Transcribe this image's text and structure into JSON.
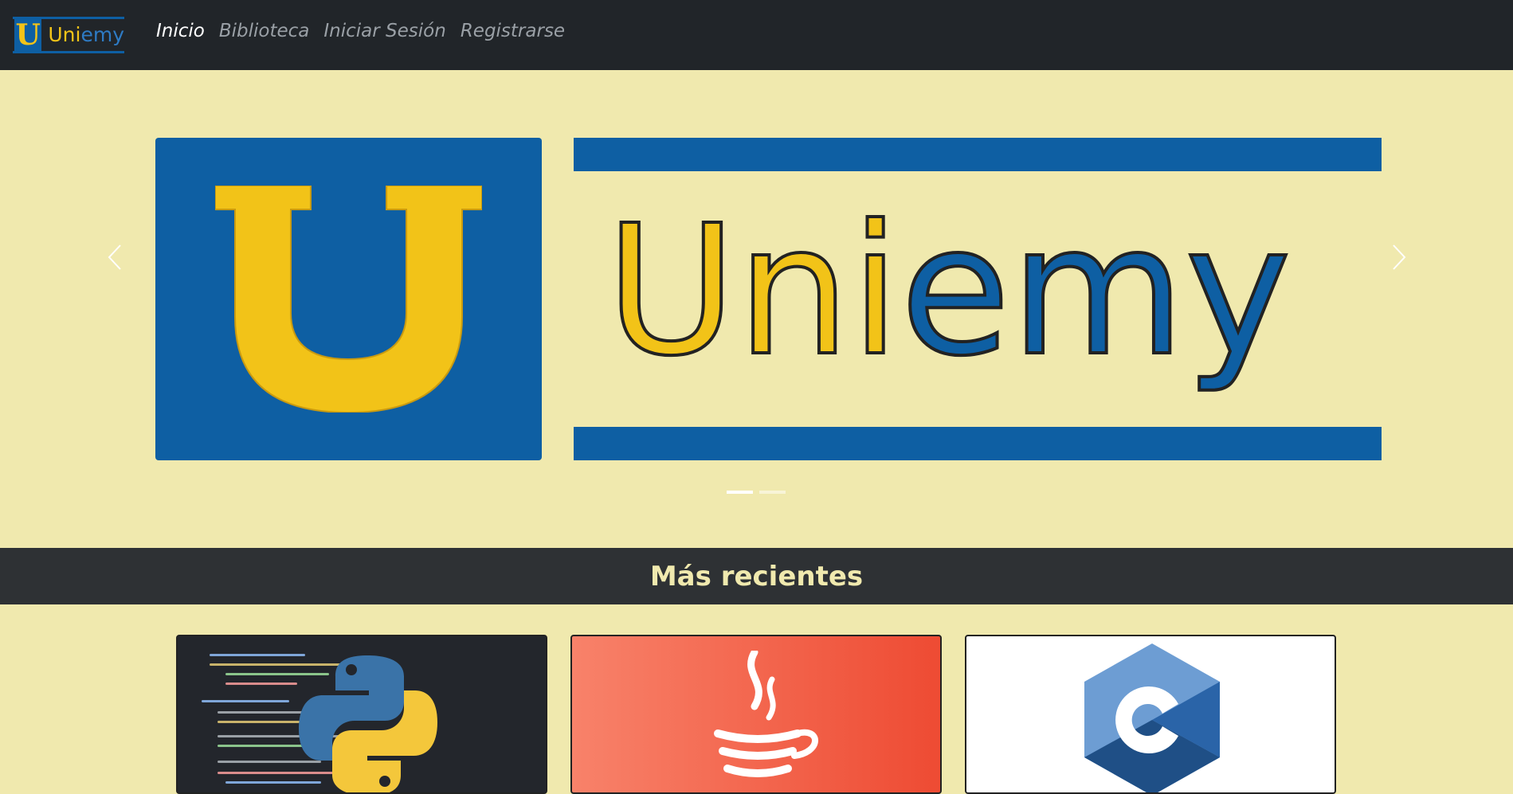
{
  "navbar": {
    "brand": {
      "letter": "U",
      "uni": "Uni",
      "emy": "emy"
    },
    "links": [
      {
        "label": "Inicio",
        "active": true
      },
      {
        "label": "Biblioteca",
        "active": false
      },
      {
        "label": "Iniciar Sesión",
        "active": false
      },
      {
        "label": "Registrarse",
        "active": false
      }
    ]
  },
  "carousel": {
    "slide_letter": "U",
    "slide_word": "Uniemy",
    "colors": {
      "blue": "#0e5fa3",
      "yellow": "#f2c318",
      "background": "#f0e9ae"
    },
    "indicators": 2,
    "active_indicator": 0
  },
  "section": {
    "title": "Más recientes"
  },
  "cards": [
    {
      "icon": "python-logo-icon"
    },
    {
      "icon": "java-logo-icon"
    },
    {
      "icon": "c-language-logo-icon"
    }
  ]
}
